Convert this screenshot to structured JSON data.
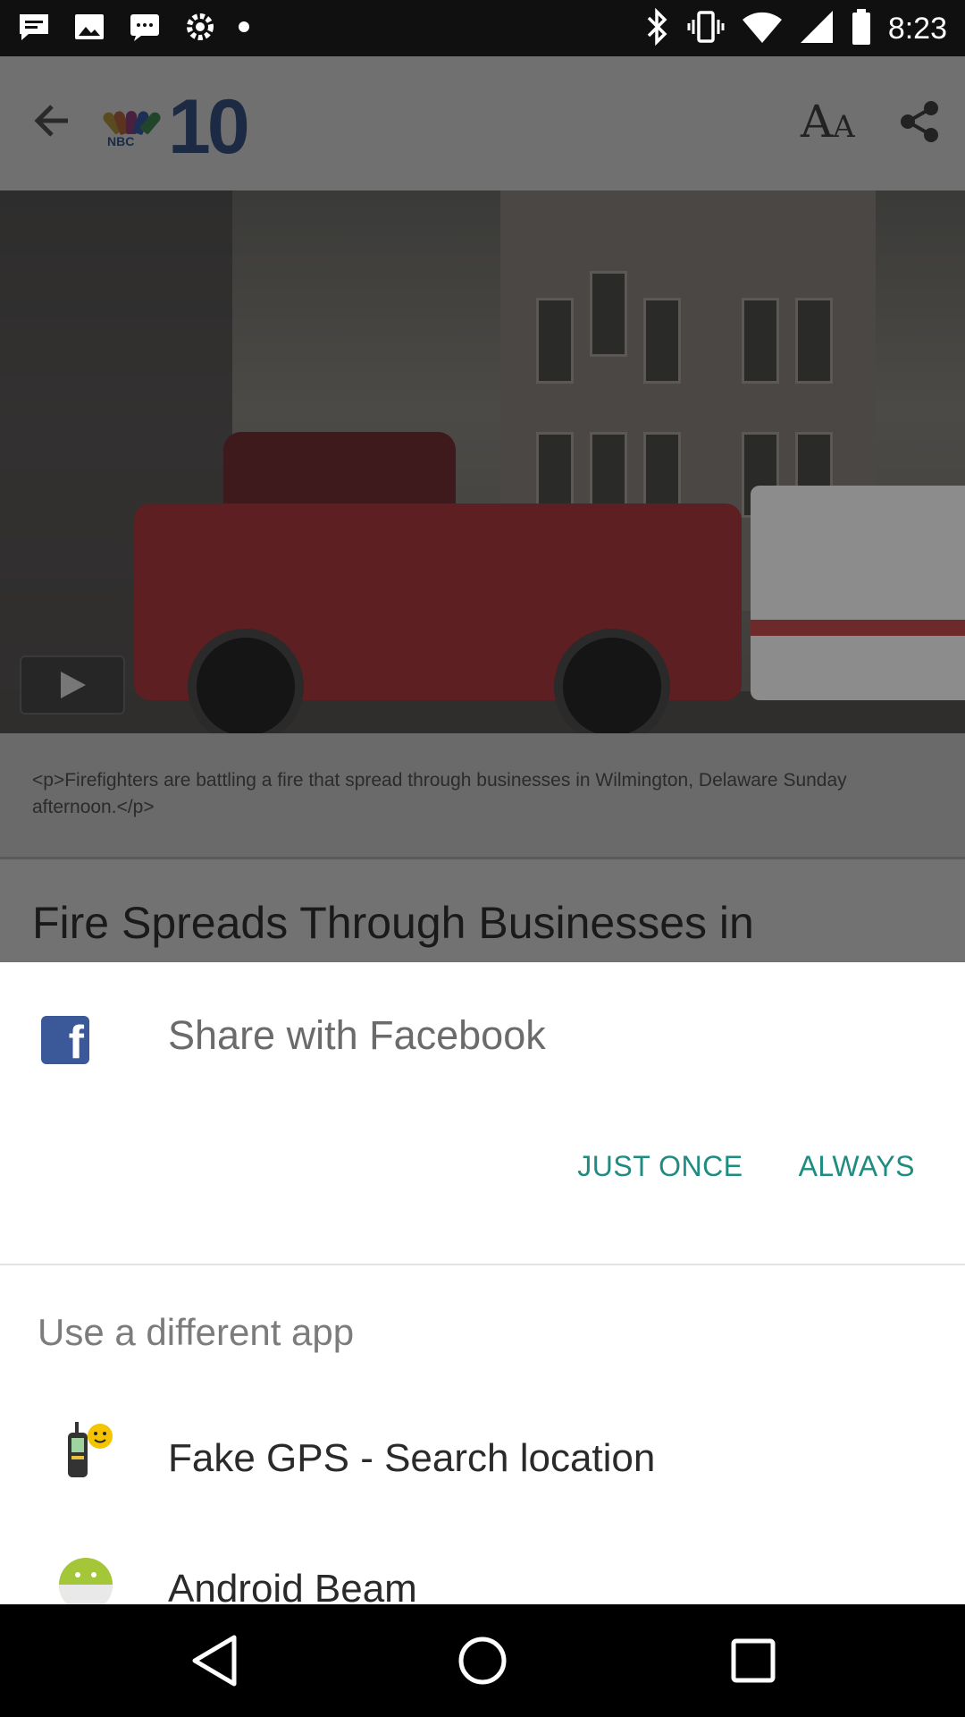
{
  "status_bar": {
    "time": "8:23",
    "left_icons": [
      "chat-icon",
      "image-icon",
      "message-icon",
      "settings-icon",
      "dot-icon"
    ],
    "right_icons": [
      "bluetooth-icon",
      "vibrate-icon",
      "wifi-icon",
      "signal-icon",
      "battery-icon"
    ]
  },
  "header": {
    "logo_small_text": "NBC",
    "logo_number": "10",
    "font_size_glyph_large": "A",
    "font_size_glyph_small": "A"
  },
  "article": {
    "caption": "<p>Firefighters are battling a fire that spread through businesses in Wilmington, Delaware Sunday afternoon.</p>",
    "headline": "Fire Spreads Through Businesses in Downtown Wilmington"
  },
  "share_sheet": {
    "title": "Share with Facebook",
    "just_once_label": "JUST ONCE",
    "always_label": "ALWAYS",
    "different_app_label": "Use a different app",
    "apps": [
      {
        "label": "Fake GPS - Search location",
        "icon": "gps-device-icon"
      },
      {
        "label": "Android Beam",
        "icon": "android-icon"
      }
    ]
  },
  "colors": {
    "accent": "#1e8c80",
    "facebook": "#3b5998",
    "nbc_dark": "#1c2a44"
  }
}
